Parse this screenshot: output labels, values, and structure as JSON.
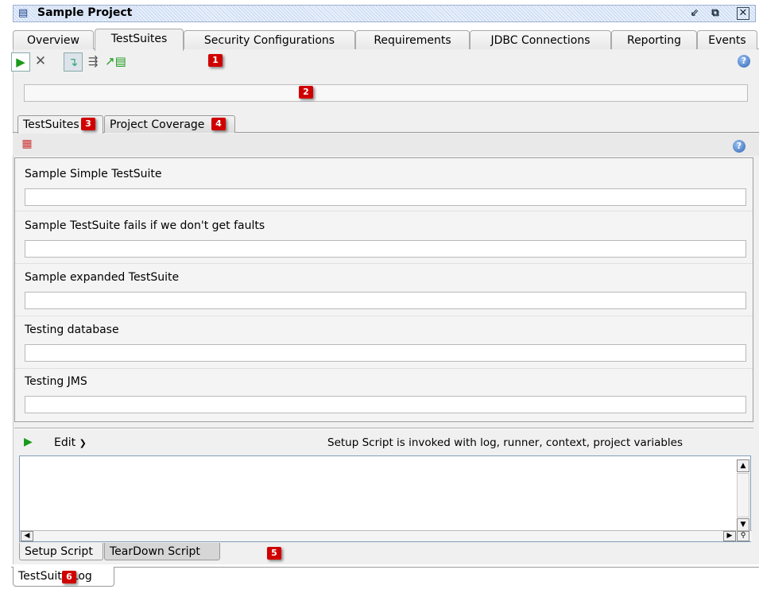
{
  "window": {
    "title": "Sample Project"
  },
  "main_tabs": [
    {
      "label": "Overview"
    },
    {
      "label": "TestSuites"
    },
    {
      "label": "Security Configurations"
    },
    {
      "label": "Requirements"
    },
    {
      "label": "JDBC Connections"
    },
    {
      "label": "Reporting"
    },
    {
      "label": "Events"
    }
  ],
  "active_main_tab": "TestSuites",
  "toolbar": {
    "icons": [
      "run-icon",
      "cancel-icon",
      "sequential-icon",
      "parallel-icon",
      "new-testsuite-icon",
      "help-icon"
    ]
  },
  "callouts": [
    "1",
    "2",
    "3",
    "4",
    "5",
    "6"
  ],
  "sub_tabs": [
    {
      "label": "TestSuites"
    },
    {
      "label": "Project Coverage"
    }
  ],
  "testsuites": [
    {
      "name": "Sample Simple TestSuite"
    },
    {
      "name": "Sample TestSuite fails if we don't get faults"
    },
    {
      "name": "Sample expanded TestSuite"
    },
    {
      "name": "Testing database"
    },
    {
      "name": "Testing JMS"
    }
  ],
  "script_panel": {
    "edit_label": "Edit",
    "info": "Setup Script is invoked with log, runner, context, project variables"
  },
  "script_tabs": [
    {
      "label": "Setup Script"
    },
    {
      "label": "TearDown Script"
    }
  ],
  "log_tab": {
    "label": "TestSuite Log"
  },
  "colors": {
    "run_green": "#1a9a1a",
    "callout_red": "#d10000",
    "title_bg": "#c5d7f2"
  }
}
